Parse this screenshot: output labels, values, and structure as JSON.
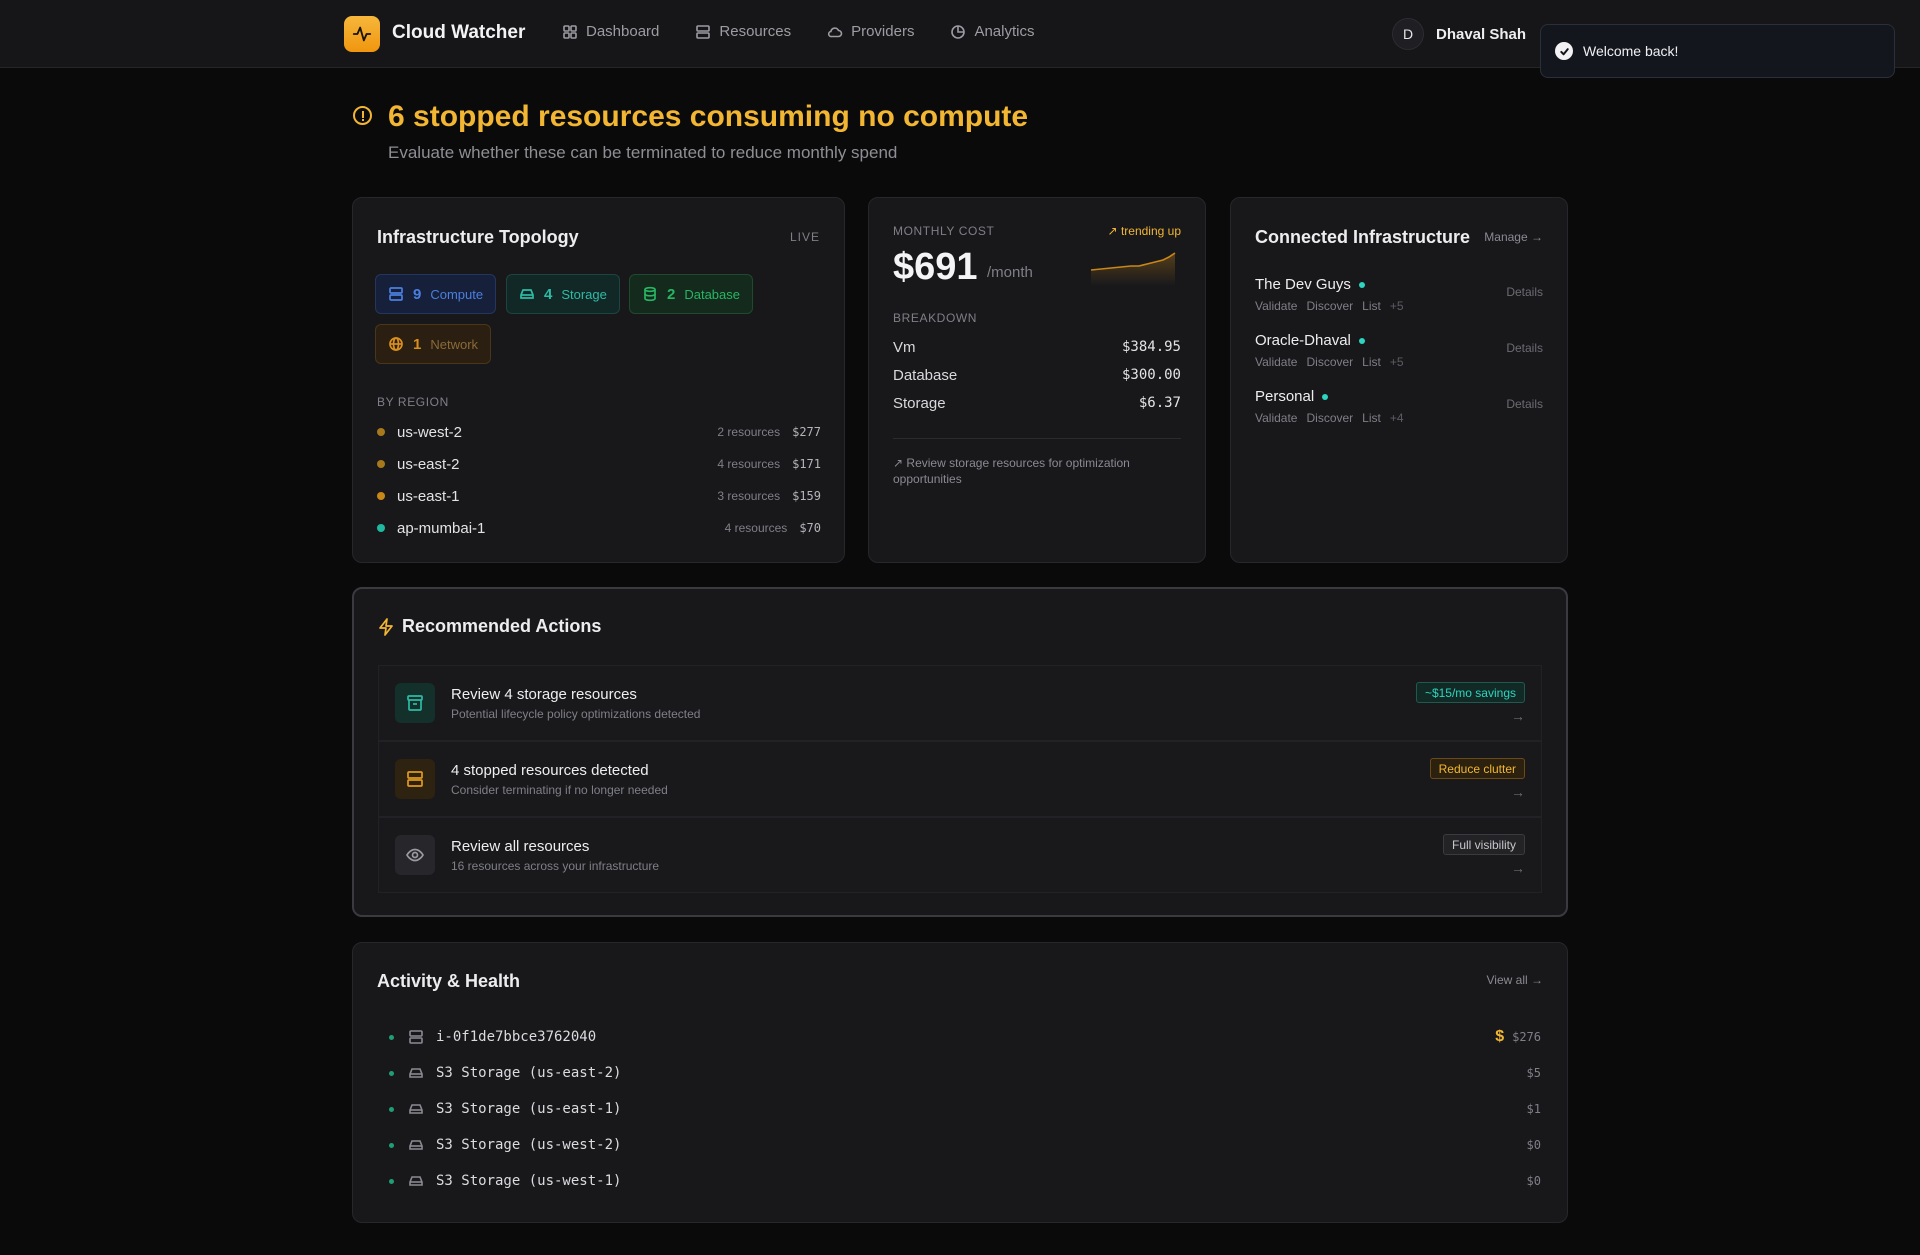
{
  "app": {
    "title": "Cloud Watcher"
  },
  "nav": [
    {
      "label": "Dashboard",
      "icon": "grid-icon"
    },
    {
      "label": "Resources",
      "icon": "server-icon"
    },
    {
      "label": "Providers",
      "icon": "cloud-icon"
    },
    {
      "label": "Analytics",
      "icon": "pie-chart-icon"
    }
  ],
  "user": {
    "initial": "D",
    "name": "Dhaval Shah"
  },
  "toast": {
    "message": "Welcome back!"
  },
  "alert": {
    "title": "6 stopped resources consuming no compute",
    "subtitle": "Evaluate whether these can be terminated to reduce monthly spend"
  },
  "topology": {
    "title": "Infrastructure Topology",
    "status": "LIVE",
    "chips": [
      {
        "count": "9",
        "label": "Compute",
        "color": "#4a7fe0"
      },
      {
        "count": "4",
        "label": "Storage",
        "color": "#2dbba6"
      },
      {
        "count": "2",
        "label": "Database",
        "color": "#28b563"
      },
      {
        "count": "1",
        "label": "Network",
        "color": "#d98e1f"
      }
    ],
    "region_label": "BY REGION",
    "regions": [
      {
        "name": "us-west-2",
        "count": "2 resources",
        "cost": "$277",
        "color": "#a8781d"
      },
      {
        "name": "us-east-2",
        "count": "4 resources",
        "cost": "$171",
        "color": "#a8781d"
      },
      {
        "name": "us-east-1",
        "count": "3 resources",
        "cost": "$159",
        "color": "#c98718"
      },
      {
        "name": "ap-mumbai-1",
        "count": "4 resources",
        "cost": "$70",
        "color": "#20b8a0"
      }
    ]
  },
  "cost": {
    "label": "MONTHLY COST",
    "trend": "trending up",
    "amount": "$691",
    "unit": "/month",
    "breakdown_label": "BREAKDOWN",
    "breakdown": [
      {
        "name": "Vm",
        "value": "$384.95"
      },
      {
        "name": "Database",
        "value": "$300.00"
      },
      {
        "name": "Storage",
        "value": "$6.37"
      }
    ],
    "note": "Review storage resources for optimization opportunities"
  },
  "connected": {
    "title": "Connected Infrastructure",
    "manage": "Manage",
    "providers": [
      {
        "name": "The Dev Guys",
        "tags": [
          "Validate",
          "Discover",
          "List"
        ],
        "more": "+5",
        "details": "Details"
      },
      {
        "name": "Oracle-Dhaval",
        "tags": [
          "Validate",
          "Discover",
          "List"
        ],
        "more": "+5",
        "details": "Details"
      },
      {
        "name": "Personal",
        "tags": [
          "Validate",
          "Discover",
          "List"
        ],
        "more": "+4",
        "details": "Details"
      }
    ]
  },
  "recommended": {
    "title": "Recommended Actions",
    "items": [
      {
        "title": "Review 4 storage resources",
        "subtitle": "Potential lifecycle policy optimizations detected",
        "badge": "~$15/mo savings",
        "icon": "archive-icon"
      },
      {
        "title": "4 stopped resources detected",
        "subtitle": "Consider terminating if no longer needed",
        "badge": "Reduce clutter",
        "icon": "server-icon"
      },
      {
        "title": "Review all resources",
        "subtitle": "16 resources across your infrastructure",
        "badge": "Full visibility",
        "icon": "eye-icon"
      }
    ]
  },
  "activity": {
    "title": "Activity & Health",
    "view_all": "View all",
    "items": [
      {
        "name": "i-0f1de7bbce3762040",
        "cost": "$276",
        "icon": "server-icon",
        "flag": "$"
      },
      {
        "name": "S3 Storage (us-east-2)",
        "cost": "$5",
        "icon": "drive-icon"
      },
      {
        "name": "S3 Storage (us-east-1)",
        "cost": "$1",
        "icon": "drive-icon"
      },
      {
        "name": "S3 Storage (us-west-2)",
        "cost": "$0",
        "icon": "drive-icon"
      },
      {
        "name": "S3 Storage (us-west-1)",
        "cost": "$0",
        "icon": "drive-icon"
      }
    ]
  }
}
